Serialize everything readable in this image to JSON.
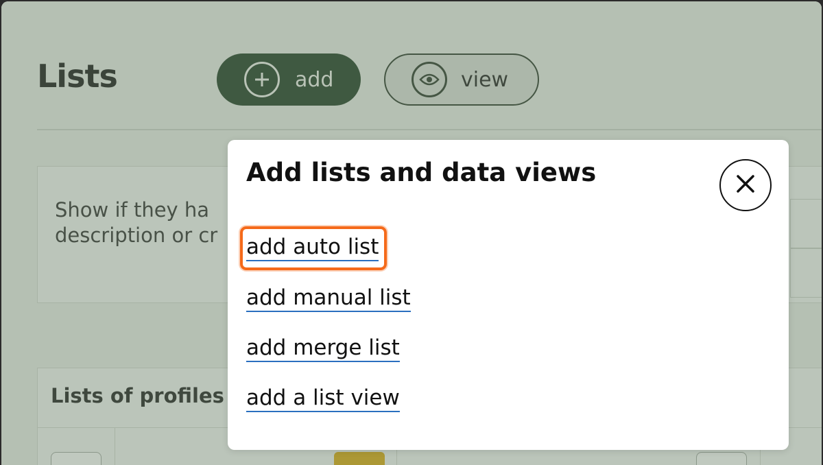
{
  "page": {
    "title": "Lists",
    "add_button_label": "add",
    "view_button_label": "view",
    "info_text_line1": "Show if they ha",
    "info_text_line2": "description or cr",
    "table_title": "Lists of profiles"
  },
  "modal": {
    "title": "Add lists and data views",
    "close_icon": "close-icon",
    "links": [
      {
        "label": "add auto list",
        "highlighted": true
      },
      {
        "label": "add manual list"
      },
      {
        "label": "add merge list"
      },
      {
        "label": "add a list view"
      }
    ]
  },
  "colors": {
    "primary_dark_green": "#123017",
    "link_underline": "#2a6fbf",
    "highlight_orange": "#f56a1a",
    "tag_yellow": "#d7a300"
  },
  "icons": [
    "plus-circle-icon",
    "eye-icon",
    "close-icon"
  ]
}
